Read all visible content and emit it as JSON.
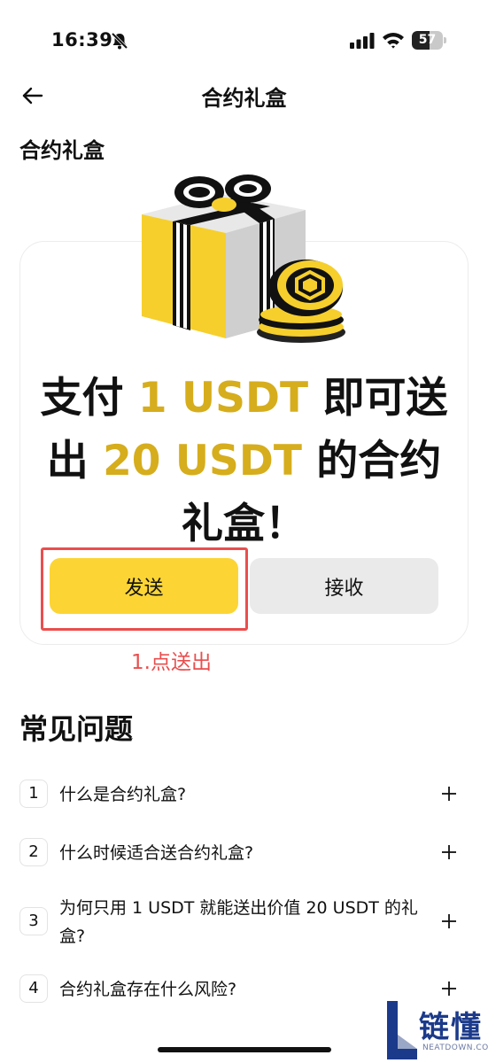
{
  "status_bar": {
    "time": "16:39",
    "battery": "57",
    "battery_level": 0.57
  },
  "nav": {
    "title": "合约礼盒"
  },
  "section": {
    "title": "合约礼盒"
  },
  "promo": {
    "line1_prefix": "支付 ",
    "line1_amount": "1 USDT",
    "line1_suffix": " 即可送出 ",
    "line2_amount": "20 USDT",
    "line2_suffix": " 的合约礼盒！",
    "accent_color": "#d6ad1c"
  },
  "actions": {
    "send_label": "发送",
    "receive_label": "接收"
  },
  "annotation": {
    "text": "1.点送出",
    "color": "#ea4e4e"
  },
  "faq": {
    "title": "常见问题",
    "items": [
      {
        "num": "1",
        "question": "什么是合约礼盒?"
      },
      {
        "num": "2",
        "question": "什么时候适合送合约礼盒?"
      },
      {
        "num": "3",
        "question": "为何只用 1 USDT 就能送出价值 20 USDT 的礼盒?"
      },
      {
        "num": "4",
        "question": "合约礼盒存在什么风险?"
      }
    ]
  },
  "watermark": {
    "name": "链懂",
    "url": "NEATDOWN.COM"
  },
  "colors": {
    "brand_yellow": "#fcd535",
    "secondary_button": "#eaeaea"
  }
}
